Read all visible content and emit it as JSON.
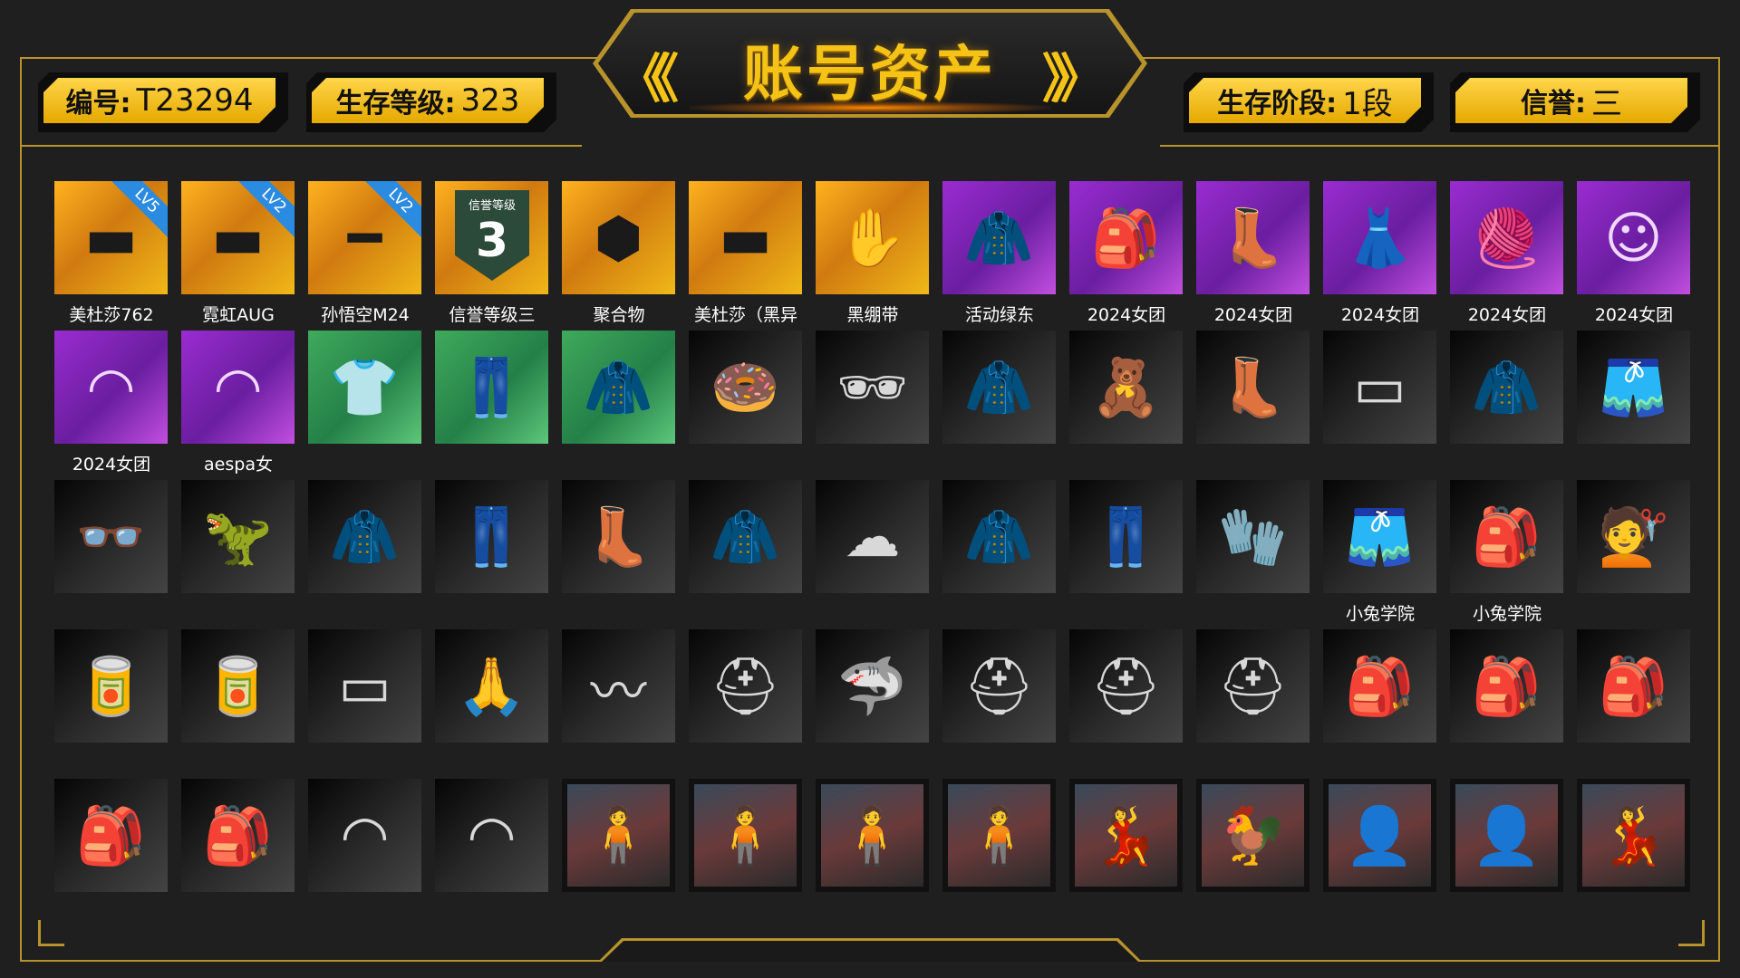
{
  "header": {
    "title": "账号资产",
    "left_chevrons": "《《",
    "right_chevrons": "》》",
    "badges": [
      {
        "label": "编号:",
        "value": "T23294"
      },
      {
        "label": "生存等级:",
        "value": "323"
      },
      {
        "label": "生存阶段:",
        "value": "1段"
      },
      {
        "label": "信誉:",
        "value": "三"
      }
    ]
  },
  "colors": {
    "accent": "#f4c316",
    "frame": "#b8922a",
    "background": "#1f1f1f"
  },
  "grid": {
    "rows": [
      [
        {
          "name": "美杜莎762",
          "icon": "assault-rifle-icon",
          "bg": "orange",
          "badge": "LV5"
        },
        {
          "name": "霓虹AUG",
          "icon": "assault-rifle-icon",
          "bg": "orange",
          "badge": "LV2"
        },
        {
          "name": "孙悟空M24",
          "icon": "sniper-rifle-icon",
          "bg": "orange",
          "badge": "LV2"
        },
        {
          "name": "信誉等级三",
          "icon": "reputation-shield-icon",
          "bg": "orange",
          "rank_title": "信誉等级",
          "rank_num": "3"
        },
        {
          "name": "聚合物",
          "icon": "polymer-hexagon-icon",
          "bg": "orange"
        },
        {
          "name": "美杜莎（黑异",
          "icon": "rifle-skin-icon",
          "bg": "orange"
        },
        {
          "name": "黑绷带",
          "icon": "bandage-icon",
          "bg": "orange"
        },
        {
          "name": "活动绿东",
          "icon": "jacket-icon",
          "bg": "purple"
        },
        {
          "name": "2024女团",
          "icon": "backpack-icon",
          "bg": "purple"
        },
        {
          "name": "2024女团",
          "icon": "boots-icon",
          "bg": "purple"
        },
        {
          "name": "2024女团",
          "icon": "outfit-icon",
          "bg": "purple"
        },
        {
          "name": "2024女团",
          "icon": "beanie-hat-icon",
          "bg": "purple"
        },
        {
          "name": "2024女团",
          "icon": "character-face-icon",
          "bg": "purple"
        }
      ],
      [
        {
          "name": "2024女团",
          "icon": "parachute-icon",
          "bg": "purple"
        },
        {
          "name": "aespa女",
          "icon": "parachute-icon",
          "bg": "purple"
        },
        {
          "name": "",
          "icon": "shirt-icon",
          "bg": "green"
        },
        {
          "name": "",
          "icon": "pants-icon",
          "bg": "green"
        },
        {
          "name": "",
          "icon": "jacket-icon",
          "bg": "green"
        },
        {
          "name": "",
          "icon": "donut-mask-icon",
          "bg": "dark"
        },
        {
          "name": "",
          "icon": "sunglasses-icon",
          "bg": "dark"
        },
        {
          "name": "",
          "icon": "jacket-icon",
          "bg": "dark"
        },
        {
          "name": "",
          "icon": "onesie-icon",
          "bg": "dark"
        },
        {
          "name": "",
          "icon": "boots-icon",
          "bg": "dark"
        },
        {
          "name": "",
          "icon": "skirt-icon",
          "bg": "dark"
        },
        {
          "name": "",
          "icon": "hoodie-icon",
          "bg": "dark"
        },
        {
          "name": "",
          "icon": "shorts-icon",
          "bg": "dark"
        }
      ],
      [
        {
          "name": "",
          "icon": "glasses-icon",
          "bg": "dark"
        },
        {
          "name": "",
          "icon": "dino-mask-icon",
          "bg": "dark"
        },
        {
          "name": "",
          "icon": "hoodie-icon",
          "bg": "dark"
        },
        {
          "name": "",
          "icon": "pants-icon",
          "bg": "dark"
        },
        {
          "name": "",
          "icon": "leggings-boots-icon",
          "bg": "dark"
        },
        {
          "name": "",
          "icon": "jacket-icon",
          "bg": "dark"
        },
        {
          "name": "",
          "icon": "bear-hat-icon",
          "bg": "dark"
        },
        {
          "name": "",
          "icon": "jacket-icon",
          "bg": "dark"
        },
        {
          "name": "",
          "icon": "camo-pants-icon",
          "bg": "dark"
        },
        {
          "name": "",
          "icon": "glove-icon",
          "bg": "dark"
        },
        {
          "name": "小兔学院",
          "icon": "shorts-icon",
          "bg": "dark"
        },
        {
          "name": "小兔学院",
          "icon": "backpack-icon",
          "bg": "dark"
        },
        {
          "name": "",
          "icon": "hairstyle-icon",
          "bg": "dark"
        }
      ],
      [
        {
          "name": "",
          "icon": "soda-can-icon",
          "bg": "dark"
        },
        {
          "name": "",
          "icon": "soda-can-icon",
          "bg": "dark"
        },
        {
          "name": "",
          "icon": "weapon-card-icon",
          "bg": "dark"
        },
        {
          "name": "",
          "icon": "monk-portrait-icon",
          "bg": "dark"
        },
        {
          "name": "",
          "icon": "heartbeat-icon",
          "bg": "dark"
        },
        {
          "name": "",
          "icon": "helmet-icon",
          "bg": "dark"
        },
        {
          "name": "",
          "icon": "shark-hat-icon",
          "bg": "dark"
        },
        {
          "name": "",
          "icon": "helmet-icon",
          "bg": "dark"
        },
        {
          "name": "",
          "icon": "helmet-icon",
          "bg": "dark"
        },
        {
          "name": "",
          "icon": "helmet-icon",
          "bg": "dark"
        },
        {
          "name": "",
          "icon": "backpack-icon",
          "bg": "dark"
        },
        {
          "name": "",
          "icon": "backpack-icon",
          "bg": "dark"
        },
        {
          "name": "",
          "icon": "backpack-icon",
          "bg": "dark"
        }
      ],
      [
        {
          "name": "",
          "icon": "backpack-icon",
          "bg": "dark"
        },
        {
          "name": "",
          "icon": "backpack-icon",
          "bg": "dark"
        },
        {
          "name": "",
          "icon": "parachute-icon",
          "bg": "dark"
        },
        {
          "name": "",
          "icon": "parachute-icon",
          "bg": "dark"
        },
        {
          "name": "",
          "icon": "character-outfit-icon",
          "bg": "scene"
        },
        {
          "name": "",
          "icon": "character-outfit-icon",
          "bg": "scene"
        },
        {
          "name": "",
          "icon": "character-outfit-icon",
          "bg": "scene"
        },
        {
          "name": "",
          "icon": "character-outfit-icon",
          "bg": "scene"
        },
        {
          "name": "",
          "icon": "cheerleader-icon",
          "bg": "scene"
        },
        {
          "name": "",
          "icon": "rooster-mascot-icon",
          "bg": "scene"
        },
        {
          "name": "",
          "icon": "character-portrait-icon",
          "bg": "scene"
        },
        {
          "name": "",
          "icon": "character-portrait-icon",
          "bg": "scene"
        },
        {
          "name": "",
          "icon": "cheerleader-icon",
          "bg": "scene"
        }
      ]
    ]
  }
}
